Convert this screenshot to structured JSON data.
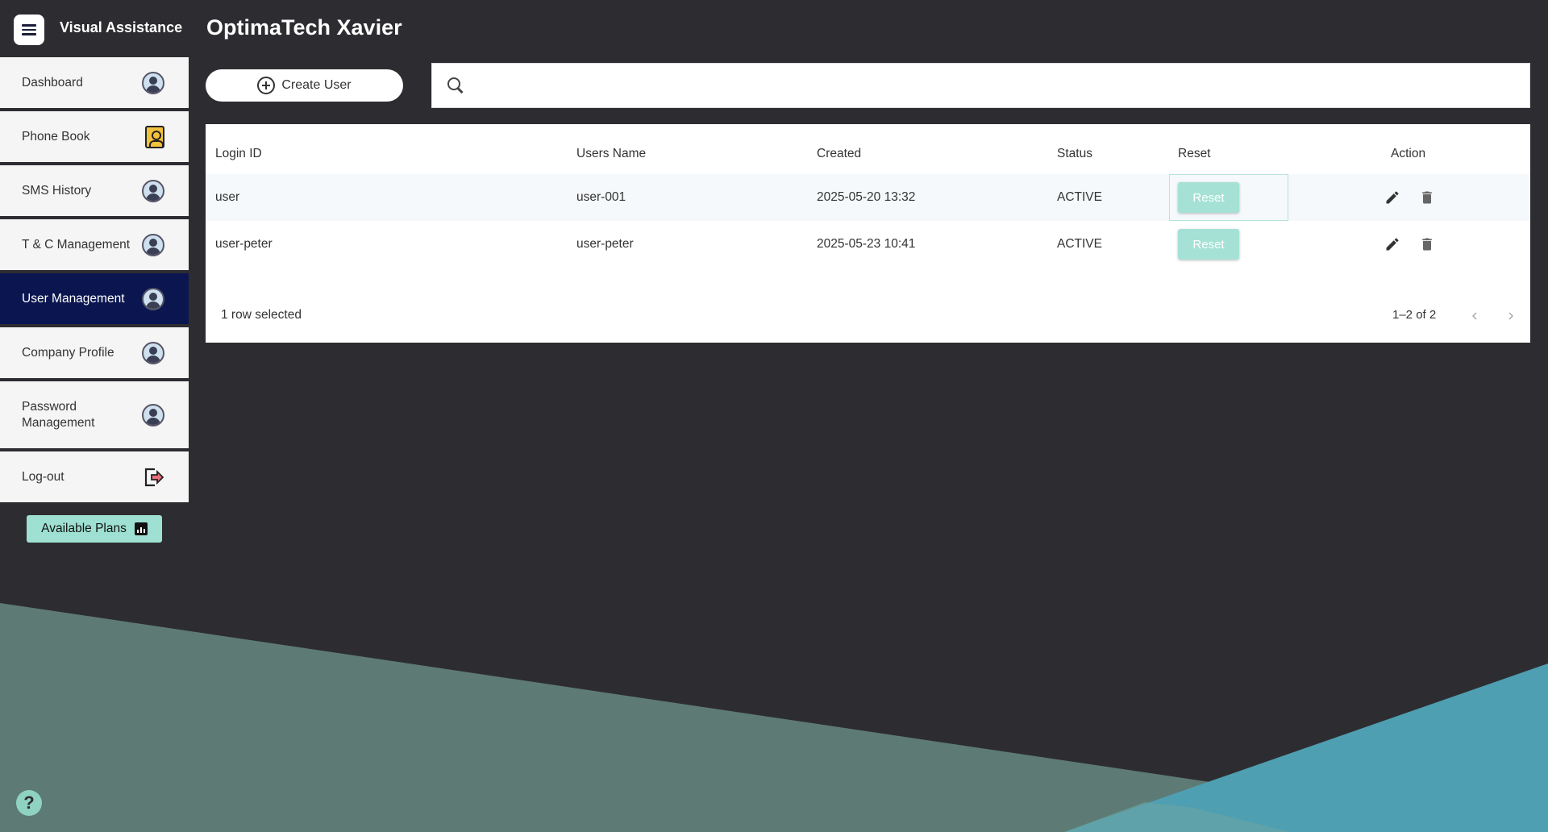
{
  "app": {
    "name": "Visual Assistance",
    "title": "OptimaTech Xavier"
  },
  "sidebar": {
    "items": [
      {
        "label": "Dashboard",
        "icon": "avatar-icon"
      },
      {
        "label": "Phone Book",
        "icon": "phonebook-icon"
      },
      {
        "label": "SMS History",
        "icon": "avatar-icon"
      },
      {
        "label": "T & C Management",
        "icon": "avatar-icon"
      },
      {
        "label": "User Management",
        "icon": "avatar-icon",
        "active": true
      },
      {
        "label": "Company Profile",
        "icon": "avatar-icon"
      },
      {
        "label": "Password Management",
        "icon": "avatar-icon"
      },
      {
        "label": "Log-out",
        "icon": "logout-icon"
      }
    ],
    "plans_label": "Available Plans"
  },
  "toolbar": {
    "create_label": "Create User",
    "search_placeholder": ""
  },
  "table": {
    "columns": [
      "Login ID",
      "Users Name",
      "Created",
      "Status",
      "Reset",
      "Action"
    ],
    "rows": [
      {
        "login_id": "user",
        "users_name": "user-001",
        "created": "2025-05-20 13:32",
        "status": "ACTIVE",
        "reset_label": "Reset"
      },
      {
        "login_id": "user-peter",
        "users_name": "user-peter",
        "created": "2025-05-23 10:41",
        "status": "ACTIVE",
        "reset_label": "Reset"
      }
    ],
    "selection_text": "1 row selected",
    "pagination_text": "1–2 of 2"
  },
  "help": {
    "label": "?"
  },
  "colors": {
    "background": "#2d2d31",
    "active_nav": "#0b1650",
    "accent": "#9ee0d2",
    "shape_teal": "#5e7a74",
    "shape_blue": "#4f9fb2"
  }
}
